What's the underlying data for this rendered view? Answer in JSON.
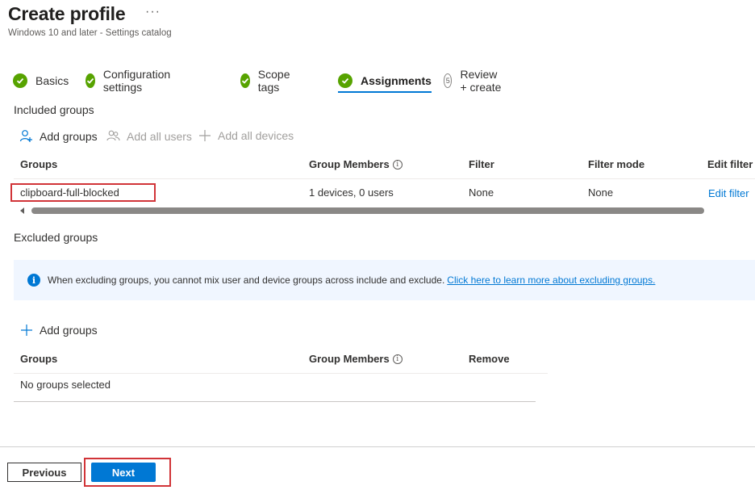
{
  "header": {
    "title": "Create profile",
    "more_label": "···",
    "subtitle": "Windows 10 and later - Settings catalog"
  },
  "steps": [
    {
      "label": "Basics",
      "state": "done"
    },
    {
      "label": "Configuration settings",
      "state": "done"
    },
    {
      "label": "Scope tags",
      "state": "done"
    },
    {
      "label": "Assignments",
      "state": "active"
    },
    {
      "label": "Review + create",
      "number": "5",
      "state": "pending"
    }
  ],
  "included": {
    "title": "Included groups",
    "commands": {
      "add_groups": "Add groups",
      "add_all_users": "Add all users",
      "add_all_devices": "Add all devices"
    },
    "columns": {
      "groups": "Groups",
      "group_members": "Group Members",
      "filter": "Filter",
      "filter_mode": "Filter mode",
      "edit_filter": "Edit filter"
    },
    "rows": [
      {
        "group": "clipboard-full-blocked",
        "members": "1 devices, 0 users",
        "filter": "None",
        "filter_mode": "None",
        "edit_filter": "Edit filter"
      }
    ]
  },
  "excluded": {
    "title": "Excluded groups",
    "info_text": "When excluding groups, you cannot mix user and device groups across include and exclude.",
    "info_link": "Click here to learn more about excluding groups.",
    "add_groups": "Add groups",
    "columns": {
      "groups": "Groups",
      "group_members": "Group Members",
      "remove": "Remove"
    },
    "empty_text": "No groups selected"
  },
  "footer": {
    "previous_label": "Previous",
    "next_label": "Next"
  },
  "colors": {
    "accent": "#0078d4",
    "success": "#57a300",
    "highlight": "#d13438"
  }
}
